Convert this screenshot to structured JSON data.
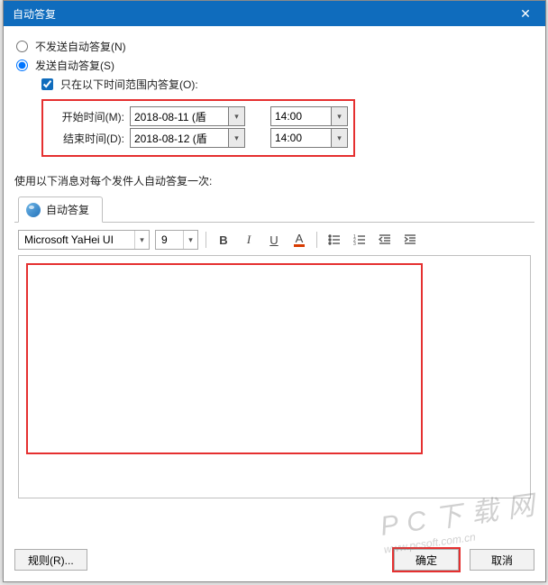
{
  "window": {
    "title": "自动答复",
    "close": "✕"
  },
  "options": {
    "dont_send_label": "不发送自动答复(N)",
    "send_label": "发送自动答复(S)",
    "only_range_label": "只在以下时间范围内答复(O):",
    "start_label": "开始时间(M):",
    "end_label": "结束时间(D):",
    "start_date": "2018-08-11 (盾",
    "start_time": "14:00",
    "end_date": "2018-08-12 (盾",
    "end_time": "14:00"
  },
  "hint_text": "使用以下消息对每个发件人自动答复一次:",
  "tab_label": "自动答复",
  "toolbar": {
    "font_name": "Microsoft YaHei UI",
    "font_size": "9"
  },
  "buttons": {
    "rules": "规则(R)...",
    "ok": "确定",
    "cancel": "取消"
  },
  "watermark_main": "P C 下 载 网",
  "watermark_sub": "www.pcsoft.com.cn"
}
